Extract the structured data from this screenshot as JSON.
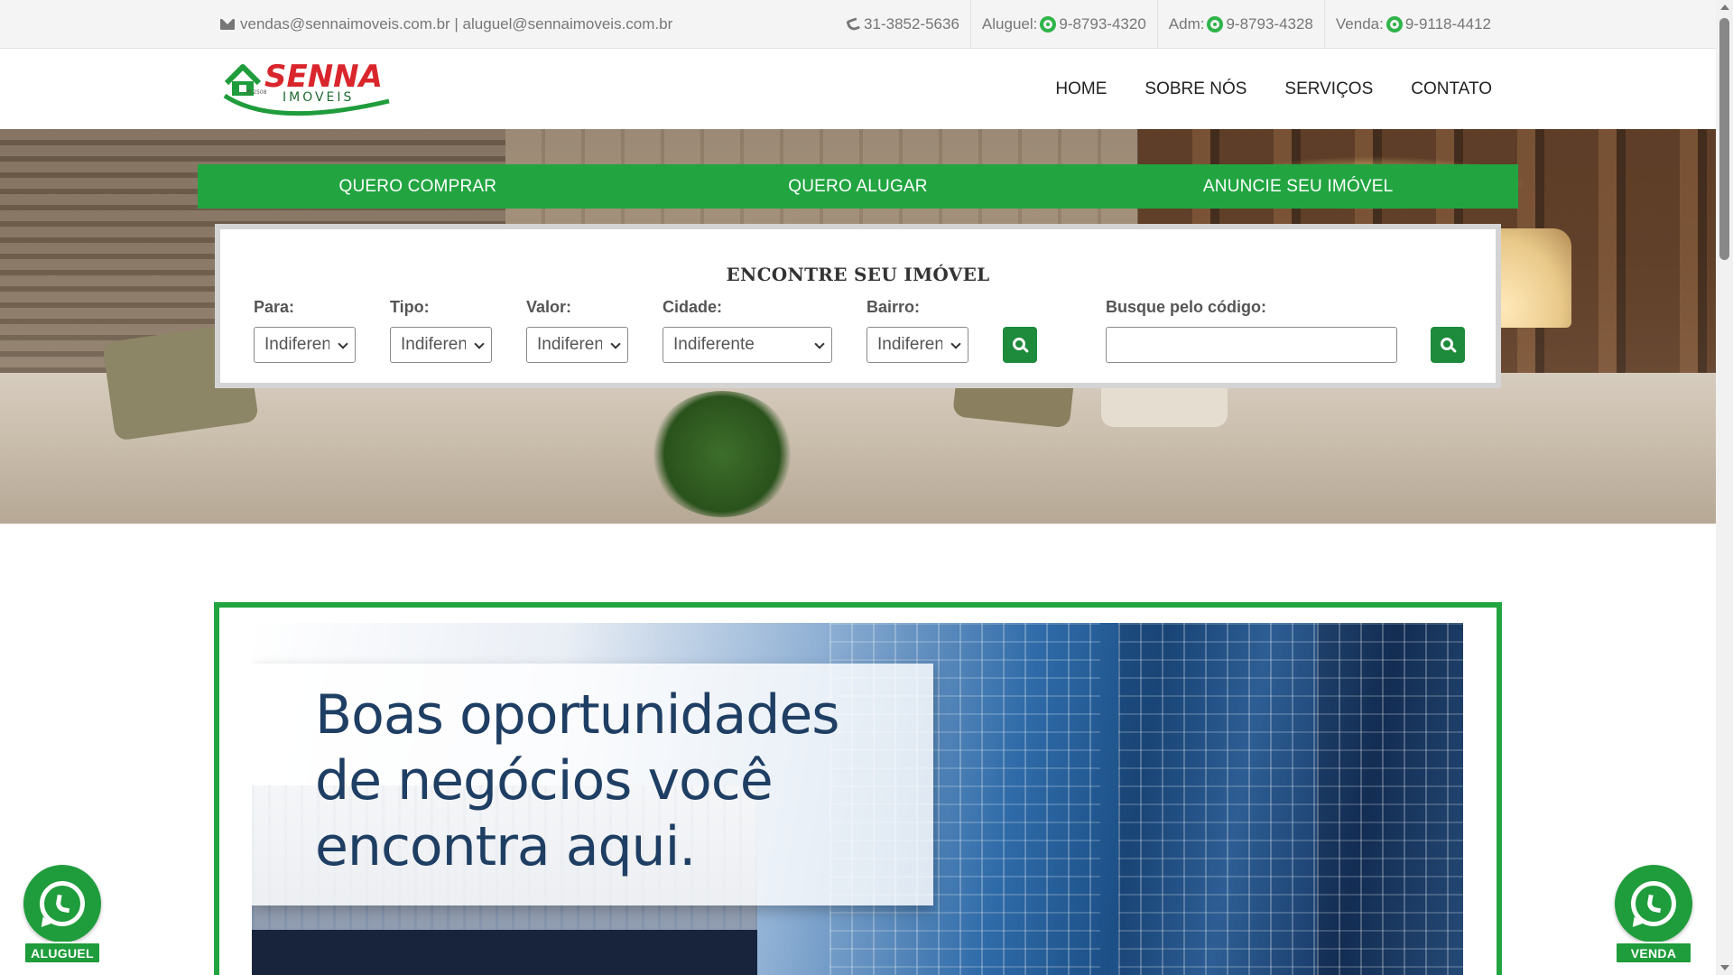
{
  "topbar": {
    "emails": "vendas@sennaimoveis.com.br | aluguel@sennaimoveis.com.br",
    "phone": "31-3852-5636",
    "aluguel_label": "Aluguel:",
    "aluguel_number": "9-8793-4320",
    "adm_label": "Adm:",
    "adm_number": "9-8793-4328",
    "venda_label": "Venda:",
    "venda_number": "9-9118-4412"
  },
  "logo": {
    "brand": "SENNA",
    "sub": "IMOVEIS",
    "tagline": "PJ 2508"
  },
  "nav": {
    "home": "HOME",
    "about": "SOBRE NÓS",
    "services": "SERVIÇOS",
    "contact": "CONTATO"
  },
  "tabs": {
    "buy": "QUERO COMPRAR",
    "rent": "QUERO ALUGAR",
    "advertise": "ANUNCIE SEU IMÓVEL"
  },
  "search": {
    "title": "ENCONTRE SEU IMÓVEL",
    "para_label": "Para:",
    "para_value": "Indiferente",
    "tipo_label": "Tipo:",
    "tipo_value": "Indiferente",
    "valor_label": "Valor:",
    "valor_value": "Indiferente",
    "cidade_label": "Cidade:",
    "cidade_value": "Indiferente",
    "bairro_label": "Bairro:",
    "bairro_value": "Indiferente",
    "codigo_label": "Busque pelo código:",
    "codigo_value": ""
  },
  "banner": {
    "line1": "Boas oportunidades",
    "line2": "de negócios  você",
    "line3": "encontra aqui."
  },
  "floating": {
    "left_label": "ALUGUEL",
    "right_label": "VENDA"
  },
  "colors": {
    "brand_green": "#22a541",
    "button_green": "#1e8a3c",
    "logo_red": "#d9262c"
  }
}
